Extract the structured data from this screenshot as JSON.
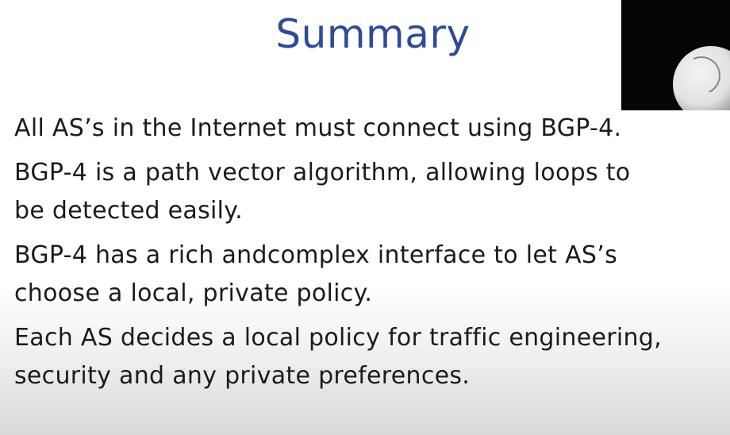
{
  "slide": {
    "title": "Summary",
    "bullets": [
      {
        "line1": "All AS’s in the Internet must connect using BGP-4.",
        "line2": ""
      },
      {
        "line1": "BGP-4 is a path vector algorithm, allowing loops to",
        "line2": "be detected easily."
      },
      {
        "line1": "BGP-4 has a rich andcomplex interface to let AS’s",
        "line2": "choose a local, private policy."
      },
      {
        "line1": "Each AS decides a local policy for traffic engineering,",
        "line2": "security and any private preferences."
      }
    ]
  },
  "colors": {
    "title": "#2f4a9a",
    "text": "#1b1b1b",
    "background_top": "#ffffff",
    "background_bottom": "#d9d9d9",
    "webcam_bg": "#050505"
  }
}
